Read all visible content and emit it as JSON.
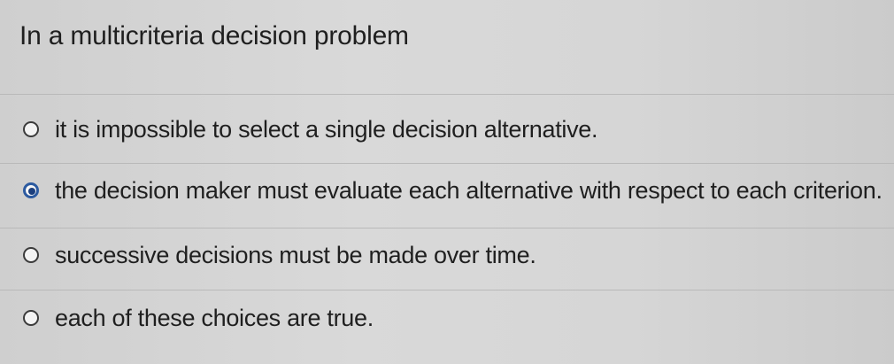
{
  "question": {
    "text": "In a multicriteria decision problem"
  },
  "options": [
    {
      "label": "it is impossible to select a single decision alternative.",
      "selected": false
    },
    {
      "label": "the decision maker must evaluate each alternative with respect to each criterion.",
      "selected": true
    },
    {
      "label": "successive decisions must be made over time.",
      "selected": false
    },
    {
      "label": "each of these choices are true.",
      "selected": false
    }
  ]
}
